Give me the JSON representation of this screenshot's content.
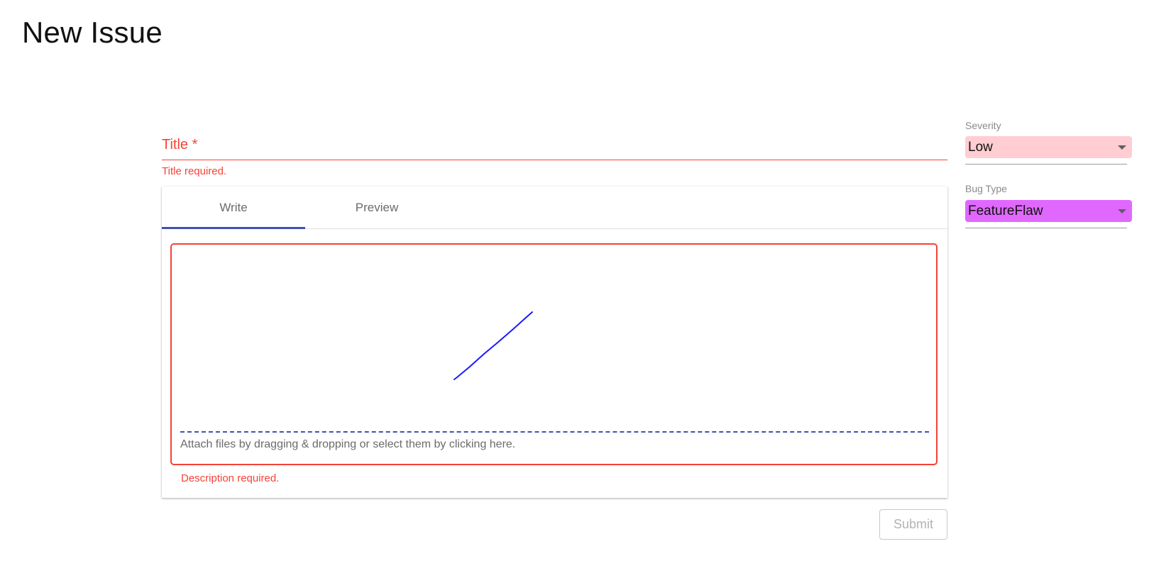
{
  "page": {
    "title": "New Issue"
  },
  "form": {
    "title_label": "Title *",
    "title_value": "",
    "title_error": "Title required.",
    "tabs": [
      {
        "label": "Write",
        "active": true
      },
      {
        "label": "Preview",
        "active": false
      }
    ],
    "description_value": "",
    "attach_text": "Attach files by dragging & dropping or select them by clicking here.",
    "description_error": "Description required.",
    "submit_label": "Submit"
  },
  "sidebar": {
    "severity": {
      "label": "Severity",
      "value": "Low",
      "color": "#ffcdd2"
    },
    "bug_type": {
      "label": "Bug Type",
      "value": "FeatureFlaw",
      "color": "#e068ff"
    }
  },
  "colors": {
    "error": "#f44336",
    "accent": "#3f51b5",
    "scribble": "#1a1aff"
  }
}
